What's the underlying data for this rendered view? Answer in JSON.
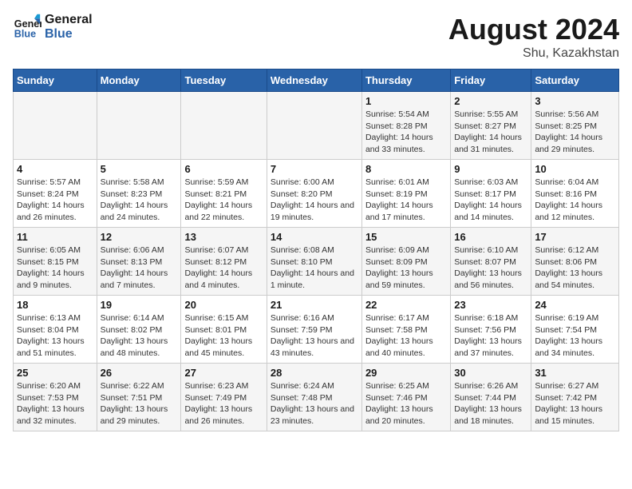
{
  "header": {
    "logo_text_general": "General",
    "logo_text_blue": "Blue",
    "month_year": "August 2024",
    "location": "Shu, Kazakhstan"
  },
  "weekdays": [
    "Sunday",
    "Monday",
    "Tuesday",
    "Wednesday",
    "Thursday",
    "Friday",
    "Saturday"
  ],
  "weeks": [
    [
      {
        "num": "",
        "info": ""
      },
      {
        "num": "",
        "info": ""
      },
      {
        "num": "",
        "info": ""
      },
      {
        "num": "",
        "info": ""
      },
      {
        "num": "1",
        "info": "Sunrise: 5:54 AM\nSunset: 8:28 PM\nDaylight: 14 hours and 33 minutes."
      },
      {
        "num": "2",
        "info": "Sunrise: 5:55 AM\nSunset: 8:27 PM\nDaylight: 14 hours and 31 minutes."
      },
      {
        "num": "3",
        "info": "Sunrise: 5:56 AM\nSunset: 8:25 PM\nDaylight: 14 hours and 29 minutes."
      }
    ],
    [
      {
        "num": "4",
        "info": "Sunrise: 5:57 AM\nSunset: 8:24 PM\nDaylight: 14 hours and 26 minutes."
      },
      {
        "num": "5",
        "info": "Sunrise: 5:58 AM\nSunset: 8:23 PM\nDaylight: 14 hours and 24 minutes."
      },
      {
        "num": "6",
        "info": "Sunrise: 5:59 AM\nSunset: 8:21 PM\nDaylight: 14 hours and 22 minutes."
      },
      {
        "num": "7",
        "info": "Sunrise: 6:00 AM\nSunset: 8:20 PM\nDaylight: 14 hours and 19 minutes."
      },
      {
        "num": "8",
        "info": "Sunrise: 6:01 AM\nSunset: 8:19 PM\nDaylight: 14 hours and 17 minutes."
      },
      {
        "num": "9",
        "info": "Sunrise: 6:03 AM\nSunset: 8:17 PM\nDaylight: 14 hours and 14 minutes."
      },
      {
        "num": "10",
        "info": "Sunrise: 6:04 AM\nSunset: 8:16 PM\nDaylight: 14 hours and 12 minutes."
      }
    ],
    [
      {
        "num": "11",
        "info": "Sunrise: 6:05 AM\nSunset: 8:15 PM\nDaylight: 14 hours and 9 minutes."
      },
      {
        "num": "12",
        "info": "Sunrise: 6:06 AM\nSunset: 8:13 PM\nDaylight: 14 hours and 7 minutes."
      },
      {
        "num": "13",
        "info": "Sunrise: 6:07 AM\nSunset: 8:12 PM\nDaylight: 14 hours and 4 minutes."
      },
      {
        "num": "14",
        "info": "Sunrise: 6:08 AM\nSunset: 8:10 PM\nDaylight: 14 hours and 1 minute."
      },
      {
        "num": "15",
        "info": "Sunrise: 6:09 AM\nSunset: 8:09 PM\nDaylight: 13 hours and 59 minutes."
      },
      {
        "num": "16",
        "info": "Sunrise: 6:10 AM\nSunset: 8:07 PM\nDaylight: 13 hours and 56 minutes."
      },
      {
        "num": "17",
        "info": "Sunrise: 6:12 AM\nSunset: 8:06 PM\nDaylight: 13 hours and 54 minutes."
      }
    ],
    [
      {
        "num": "18",
        "info": "Sunrise: 6:13 AM\nSunset: 8:04 PM\nDaylight: 13 hours and 51 minutes."
      },
      {
        "num": "19",
        "info": "Sunrise: 6:14 AM\nSunset: 8:02 PM\nDaylight: 13 hours and 48 minutes."
      },
      {
        "num": "20",
        "info": "Sunrise: 6:15 AM\nSunset: 8:01 PM\nDaylight: 13 hours and 45 minutes."
      },
      {
        "num": "21",
        "info": "Sunrise: 6:16 AM\nSunset: 7:59 PM\nDaylight: 13 hours and 43 minutes."
      },
      {
        "num": "22",
        "info": "Sunrise: 6:17 AM\nSunset: 7:58 PM\nDaylight: 13 hours and 40 minutes."
      },
      {
        "num": "23",
        "info": "Sunrise: 6:18 AM\nSunset: 7:56 PM\nDaylight: 13 hours and 37 minutes."
      },
      {
        "num": "24",
        "info": "Sunrise: 6:19 AM\nSunset: 7:54 PM\nDaylight: 13 hours and 34 minutes."
      }
    ],
    [
      {
        "num": "25",
        "info": "Sunrise: 6:20 AM\nSunset: 7:53 PM\nDaylight: 13 hours and 32 minutes."
      },
      {
        "num": "26",
        "info": "Sunrise: 6:22 AM\nSunset: 7:51 PM\nDaylight: 13 hours and 29 minutes."
      },
      {
        "num": "27",
        "info": "Sunrise: 6:23 AM\nSunset: 7:49 PM\nDaylight: 13 hours and 26 minutes."
      },
      {
        "num": "28",
        "info": "Sunrise: 6:24 AM\nSunset: 7:48 PM\nDaylight: 13 hours and 23 minutes."
      },
      {
        "num": "29",
        "info": "Sunrise: 6:25 AM\nSunset: 7:46 PM\nDaylight: 13 hours and 20 minutes."
      },
      {
        "num": "30",
        "info": "Sunrise: 6:26 AM\nSunset: 7:44 PM\nDaylight: 13 hours and 18 minutes."
      },
      {
        "num": "31",
        "info": "Sunrise: 6:27 AM\nSunset: 7:42 PM\nDaylight: 13 hours and 15 minutes."
      }
    ]
  ]
}
